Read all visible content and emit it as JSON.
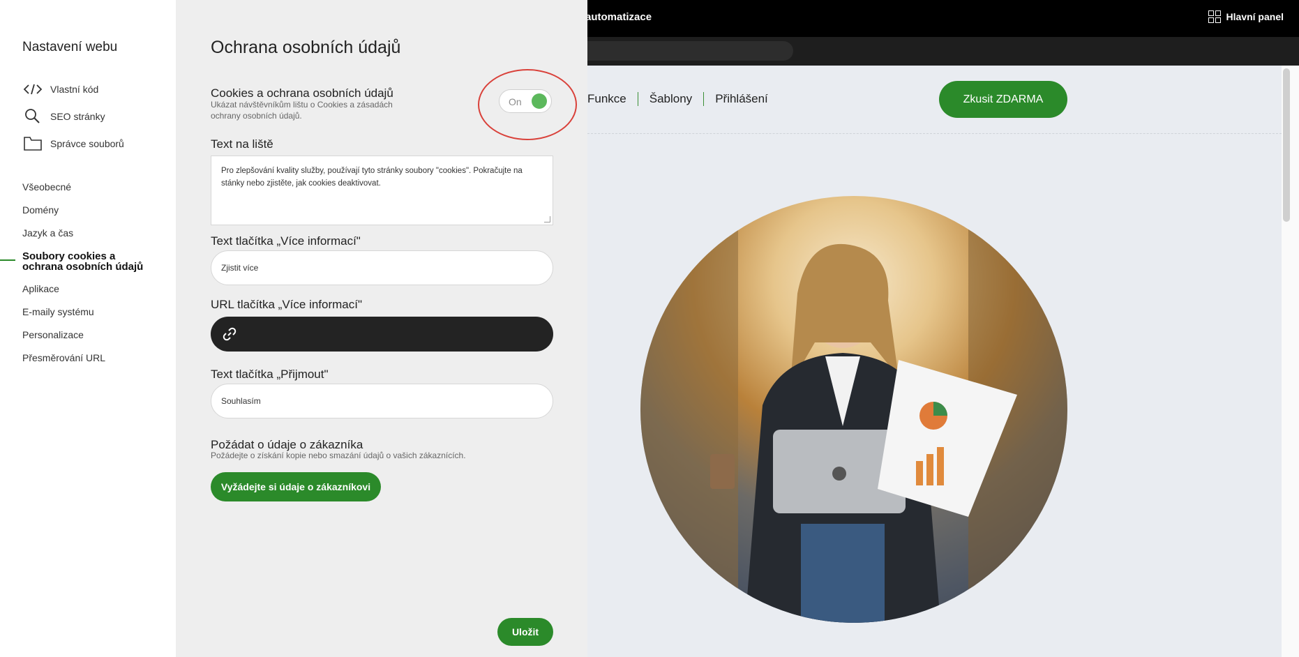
{
  "topbar": {
    "breadcrumb": "automatizace",
    "dashboard_label": "Hlavní panel"
  },
  "site": {
    "nav_links": [
      "Funkce",
      "Šablony",
      "Přihlášení"
    ],
    "cta_label": "Zkusit ZDARMA"
  },
  "sidebar": {
    "title": "Nastavení webu",
    "tools": [
      {
        "label": "Vlastní kód",
        "icon": "code-icon"
      },
      {
        "label": "SEO stránky",
        "icon": "search-icon"
      },
      {
        "label": "Správce souborů",
        "icon": "folder-icon"
      }
    ],
    "menu": [
      {
        "label": "Všeobecné"
      },
      {
        "label": "Domény"
      },
      {
        "label": "Jazyk a čas"
      },
      {
        "label": "Soubory cookies a ochrana osobních údajů",
        "active": true
      },
      {
        "label": "Aplikace"
      },
      {
        "label": "E-maily systému"
      },
      {
        "label": "Personalizace"
      },
      {
        "label": "Přesměrování URL"
      }
    ]
  },
  "panel": {
    "title": "Ochrana osobních údajů",
    "cookies": {
      "title": "Cookies a ochrana osobních údajů",
      "description": "Ukázat návštěvníkům lištu o Cookies a zásadách ochrany osobních údajů.",
      "toggle_state": "On"
    },
    "bar_text": {
      "label": "Text na liště",
      "value": "Pro zlepšování kvality služby, používají tyto stránky soubory \"cookies\". Pokračujte na stánky nebo zjistěte, jak cookies deaktivovat."
    },
    "more_info_text": {
      "label": "Text tlačítka „Více informací\"",
      "value": "Zjistit více"
    },
    "more_info_url": {
      "label": "URL tlačítka „Více informací\"",
      "value": ""
    },
    "accept_text": {
      "label": "Text tlačítka „Přijmout\"",
      "value": "Souhlasím"
    },
    "customer_data": {
      "title": "Požádat o údaje o zákazníka",
      "description": "Požádejte o získání kopie nebo smazání údajů o vašich zákaznících.",
      "button_label": "Vyžádejte si údaje o zákazníkovi"
    },
    "save_label": "Uložit"
  },
  "colors": {
    "accent_green": "#2b8a2a",
    "toggle_green": "#5cb85c",
    "annotation_red": "#d9413a"
  }
}
